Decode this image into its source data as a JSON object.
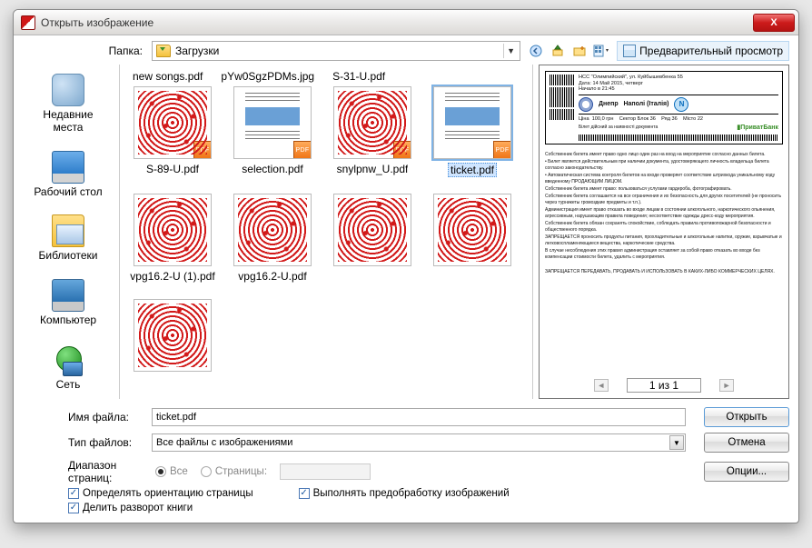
{
  "window": {
    "title": "Открыть изображение",
    "close_symbol": "X"
  },
  "top": {
    "folder_label": "Папка:",
    "folder_value": "Загрузки",
    "preview_label": "Предварительный просмотр",
    "icon_back": "←",
    "icon_up": "↑",
    "icon_newfolder": "✱",
    "icon_view": "▦"
  },
  "sidebar": [
    {
      "key": "recent",
      "label": "Недавние места"
    },
    {
      "key": "desktop",
      "label": "Рабочий стол"
    },
    {
      "key": "libs",
      "label": "Библиотеки"
    },
    {
      "key": "computer",
      "label": "Компьютер"
    },
    {
      "key": "network",
      "label": "Сеть"
    }
  ],
  "top_name_row": [
    "new songs.pdf",
    "pYw0SgzPDMs.jpg",
    "S-31-U.pdf"
  ],
  "files": [
    {
      "label": "S-89-U.pdf",
      "kind": "redspray",
      "pdf": true
    },
    {
      "label": "selection.pdf",
      "kind": "docpage",
      "pdf": true
    },
    {
      "label": "snylpnw_U.pdf",
      "kind": "redspray",
      "pdf": true
    },
    {
      "label": "ticket.pdf",
      "kind": "docpage",
      "pdf": true,
      "selected": true
    },
    {
      "label": "vpg16.2-U (1).pdf",
      "kind": "redspray",
      "pdf": false
    },
    {
      "label": "vpg16.2-U.pdf",
      "kind": "redspray",
      "pdf": false
    },
    {
      "label": "",
      "kind": "redspray",
      "pdf": false
    },
    {
      "label": "",
      "kind": "redspray",
      "pdf": false
    },
    {
      "label": "",
      "kind": "redspray",
      "pdf": false
    }
  ],
  "preview": {
    "page_counter": "1 из 1"
  },
  "form": {
    "filename_label": "Имя файла:",
    "filename_value": "ticket.pdf",
    "filetype_label": "Тип файлов:",
    "filetype_value": "Все файлы с изображениями",
    "open_btn": "Открыть",
    "cancel_btn": "Отмена",
    "options_btn": "Опции...",
    "range_label": "Диапазон страниц:",
    "range_all": "Все",
    "range_pages": "Страницы:",
    "chk_orientation": "Определять ориентацию страницы",
    "chk_preprocess": "Выполнять предобработку изображений",
    "chk_splitbook": "Делить разворот книги"
  }
}
